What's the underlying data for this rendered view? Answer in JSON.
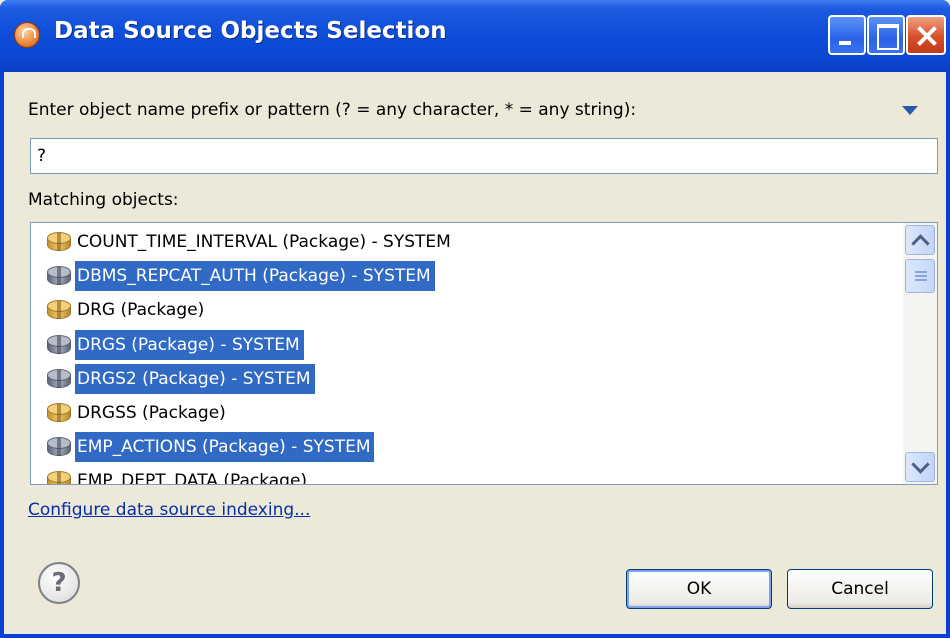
{
  "window": {
    "title": "Data Source Objects Selection"
  },
  "search": {
    "prompt": "Enter object name prefix or pattern (? = any character, * = any string):",
    "value": "?"
  },
  "matching": {
    "label": "Matching objects:",
    "items": [
      {
        "label": "COUNT_TIME_INTERVAL (Package) - SYSTEM",
        "icon": "package-icon",
        "selected": false
      },
      {
        "label": "DBMS_REPCAT_AUTH (Package) - SYSTEM",
        "icon": "package-gray-icon",
        "selected": true
      },
      {
        "label": "DRG (Package)",
        "icon": "package-icon",
        "selected": false
      },
      {
        "label": "DRGS (Package) - SYSTEM",
        "icon": "package-gray-icon",
        "selected": true
      },
      {
        "label": "DRGS2 (Package) - SYSTEM",
        "icon": "package-gray-icon",
        "selected": true
      },
      {
        "label": "DRGSS (Package)",
        "icon": "package-icon",
        "selected": false
      },
      {
        "label": "EMP_ACTIONS (Package) - SYSTEM",
        "icon": "package-gray-icon",
        "selected": true
      },
      {
        "label": "EMP_DEPT_DATA (Package)",
        "icon": "package-icon",
        "selected": false
      }
    ]
  },
  "links": {
    "configure": "Configure data source indexing..."
  },
  "buttons": {
    "help": "?",
    "ok": "OK",
    "cancel": "Cancel"
  },
  "colors": {
    "selection": "#316ac5",
    "titlebar": "#0b47d3",
    "link": "#0a2ea6"
  }
}
